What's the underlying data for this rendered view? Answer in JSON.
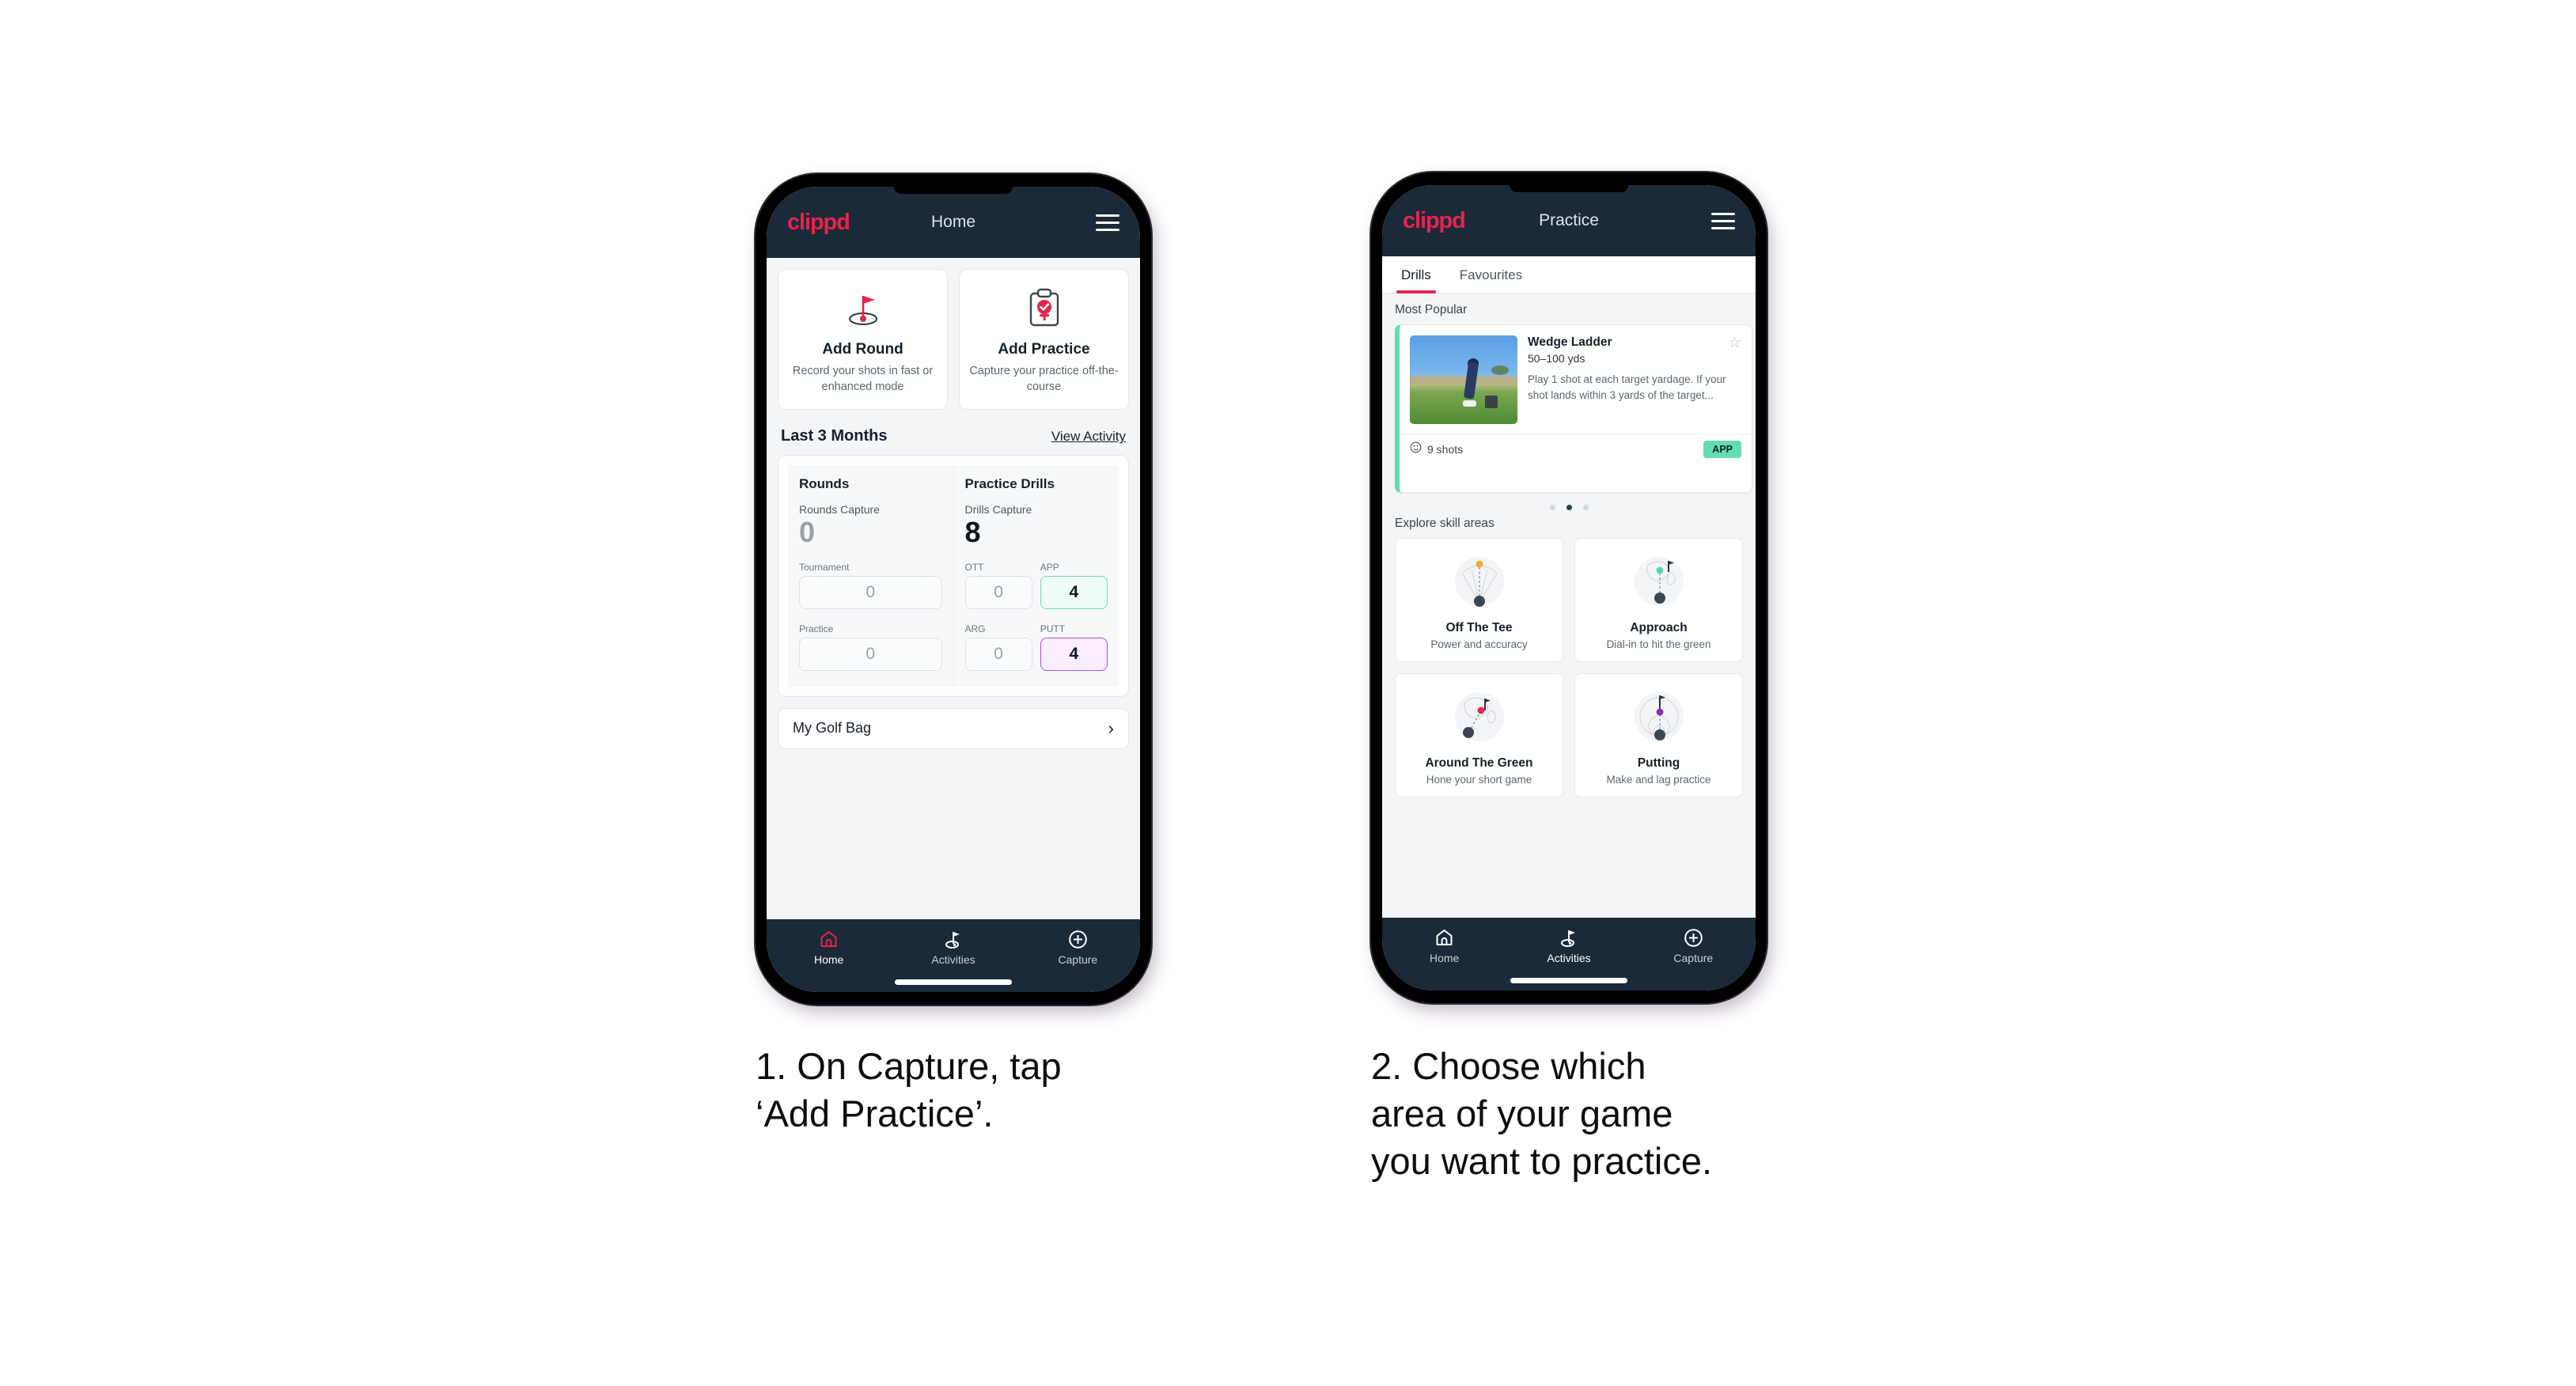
{
  "phone1": {
    "header": {
      "logo": "clippd",
      "title": "Home",
      "menu_icon": "hamburger-icon"
    },
    "quick_actions": [
      {
        "icon": "golf-flag-icon",
        "title": "Add Round",
        "subtitle": "Record your shots in fast or enhanced mode"
      },
      {
        "icon": "clipboard-check-icon",
        "title": "Add Practice",
        "subtitle": "Capture your practice off-the-course"
      }
    ],
    "section": {
      "title": "Last 3 Months",
      "link": "View Activity"
    },
    "stats": {
      "rounds": {
        "heading": "Rounds",
        "capture_label": "Rounds Capture",
        "capture_value": "0",
        "metrics": [
          {
            "label": "Tournament",
            "value": "0",
            "highlight": "none"
          },
          {
            "label": "Practice",
            "value": "0",
            "highlight": "none"
          }
        ]
      },
      "drills": {
        "heading": "Practice Drills",
        "capture_label": "Drills Capture",
        "capture_value": "8",
        "metrics": [
          {
            "label": "OTT",
            "value": "0",
            "highlight": "none"
          },
          {
            "label": "APP",
            "value": "4",
            "highlight": "mint"
          },
          {
            "label": "ARG",
            "value": "0",
            "highlight": "none"
          },
          {
            "label": "PUTT",
            "value": "4",
            "highlight": "violet"
          }
        ]
      }
    },
    "golf_bag": {
      "label": "My Golf Bag",
      "chevron": "chevron-right-icon"
    },
    "bottom_nav": [
      {
        "icon": "home-icon",
        "label": "Home",
        "active": true
      },
      {
        "icon": "golf-flag-activities-icon",
        "label": "Activities",
        "active": false
      },
      {
        "icon": "plus-circle-icon",
        "label": "Capture",
        "active": false
      }
    ]
  },
  "phone2": {
    "header": {
      "logo": "clippd",
      "title": "Practice",
      "menu_icon": "hamburger-icon"
    },
    "tabs": [
      {
        "label": "Drills",
        "active": true
      },
      {
        "label": "Favourites",
        "active": false
      }
    ],
    "most_popular_heading": "Most Popular",
    "drill": {
      "name": "Wedge Ladder",
      "yardage": "50–100 yds",
      "description": "Play 1 shot at each target yardage. If your shot lands within 3 yards of the target...",
      "shots": "9 shots",
      "tag": "APP",
      "star_icon": "star-outline-icon",
      "shots_icon": "target-icon",
      "accent_color": "#64dcb1",
      "next_accent_color": "#a935e0"
    },
    "carousel_dots": {
      "count": 3,
      "active_index": 1
    },
    "skill_heading": "Explore skill areas",
    "skill_areas": [
      {
        "icon": "off-the-tee-icon",
        "title": "Off The Tee",
        "subtitle": "Power and accuracy",
        "dot_color": "#f3a92b"
      },
      {
        "icon": "approach-icon",
        "title": "Approach",
        "subtitle": "Dial-in to hit the green",
        "dot_color": "#4fd7b0"
      },
      {
        "icon": "around-the-green-icon",
        "title": "Around The Green",
        "subtitle": "Hone your short game",
        "dot_color": "#e6234f"
      },
      {
        "icon": "putting-icon",
        "title": "Putting",
        "subtitle": "Make and lag practice",
        "dot_color": "#8a2ec0"
      }
    ],
    "bottom_nav": [
      {
        "icon": "home-icon",
        "label": "Home",
        "active": false
      },
      {
        "icon": "golf-flag-activities-icon",
        "label": "Activities",
        "active": true
      },
      {
        "icon": "plus-circle-icon",
        "label": "Capture",
        "active": false
      }
    ]
  },
  "captions": {
    "step1": "1. On Capture, tap\n‘Add Practice’.",
    "step2": "2. Choose which\narea of your game\nyou want to practice."
  },
  "colors": {
    "brand_pink": "#e6234f",
    "header_dark": "#1b2a38",
    "mint": "#64dcb1",
    "violet": "#a935e0",
    "page_bg": "#f4f5f7"
  }
}
